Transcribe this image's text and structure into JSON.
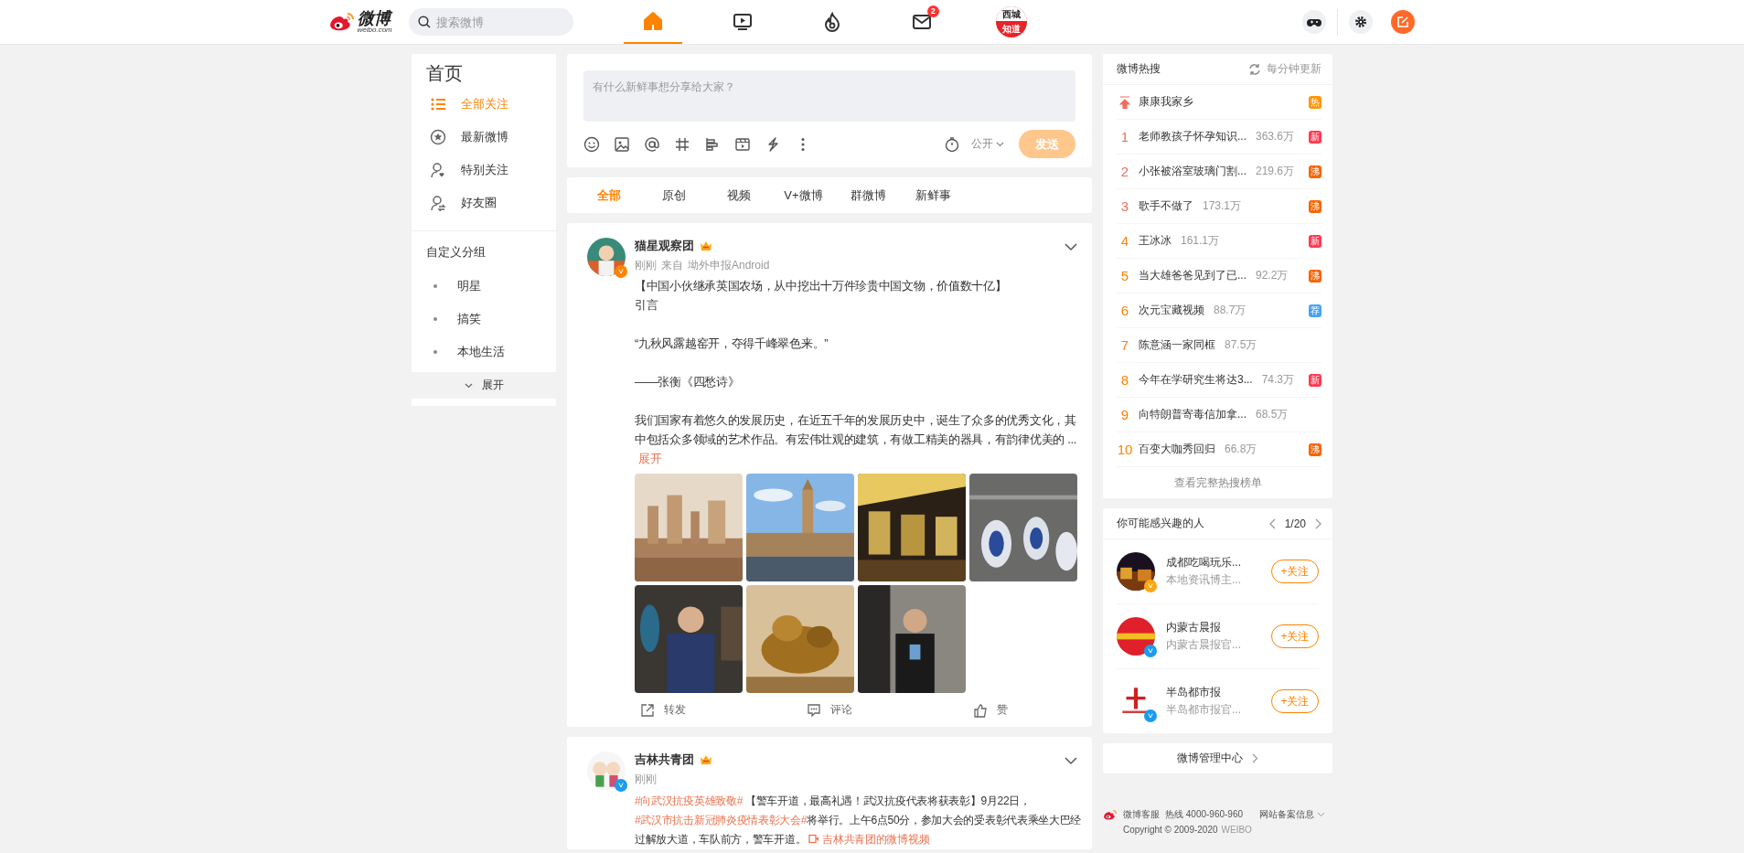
{
  "topbar": {
    "logo_text": "微博",
    "logo_sub": "weibo.com",
    "search": {
      "placeholder": "搜索微博"
    },
    "nav": [
      {
        "selected": true
      },
      {
        "selected": false
      },
      {
        "selected": false
      },
      {
        "selected": false,
        "badge": "2"
      },
      {
        "selected": false,
        "lines": [
          "西城",
          "知道"
        ]
      }
    ]
  },
  "sidebar": {
    "title": "首页",
    "items": [
      {
        "label": "全部关注",
        "selected": true
      },
      {
        "label": "最新微博",
        "selected": false
      },
      {
        "label": "特别关注",
        "selected": false
      },
      {
        "label": "好友圈",
        "selected": false
      }
    ],
    "groups_title": "自定义分组",
    "groups": [
      "明星",
      "搞笑",
      "本地生活"
    ],
    "expand": "展开"
  },
  "compose": {
    "placeholder": "有什么新鲜事想分享给大家？",
    "visibility": "公开",
    "send": {
      "label": "发送",
      "disabled": true
    }
  },
  "feed_tabs": [
    {
      "label": "全部",
      "selected": true
    },
    {
      "label": "原创",
      "selected": false
    },
    {
      "label": "视频",
      "selected": false
    },
    {
      "label": "V+微博",
      "selected": false
    },
    {
      "label": "群微博",
      "selected": false
    },
    {
      "label": "新鲜事",
      "selected": false
    }
  ],
  "posts": [
    {
      "author": "猫星观察团",
      "badge": {
        "color": "#ff8200"
      },
      "time": "刚刚",
      "source_prefix": "来自",
      "source": "坳外申报Android",
      "paragraphs": [
        [
          "【中国小伙继承英国农场，从中挖出十万件珍贵中国文物，价值数十亿】",
          "引言"
        ],
        [
          "“九秋风露越窑开，夺得千峰翠色来。”"
        ],
        [
          "——张衡《四愁诗》"
        ],
        [
          "我们国家有着悠久的发展历史，在近五千年的发展历史中，诞生了众多的优秀文化，其中包括众多领域的艺术作品。有宏伟壮观的建筑，有做工精美的器具，有韵律优美的 ..."
        ]
      ],
      "more": "展开",
      "images": [
        {
          "kind": "picture"
        },
        {
          "kind": "picture"
        },
        {
          "kind": "picture"
        },
        {
          "kind": "picture"
        },
        {
          "kind": "picture"
        },
        {
          "kind": "picture"
        },
        {
          "kind": "picture"
        }
      ],
      "actions": [
        "转发",
        "评论",
        "赞"
      ]
    },
    {
      "author": "吉林共青团",
      "badge": {
        "color": "#1a9cf2"
      },
      "time": "刚刚",
      "segments": [
        {
          "kind": "topic",
          "text": "#向武汉抗疫英雄致敬#"
        },
        {
          "kind": "plain",
          "text": " 【警车开道，最高礼遇！武汉抗疫代表将获表彰】9月22日，"
        },
        {
          "kind": "topic",
          "text": "#武汉市抗击新冠肺炎疫情表彰大会#"
        },
        {
          "kind": "plain",
          "text": "将举行。上午6点50分，参加大会的受表彰代表乘坐大巴经过解放大道，车队前方，警车开道。 "
        },
        {
          "kind": "video",
          "text": "吉林共青团的微博视频"
        }
      ]
    }
  ],
  "hot": {
    "title": "微博热搜",
    "refresh": "每分钟更新",
    "footer": "查看完整热搜榜单",
    "items": [
      {
        "kind": "pinned",
        "title": "康康我家乡",
        "tag": {
          "label": "热",
          "color": "#ff9406"
        }
      },
      {
        "kind": "ranked",
        "rank": "1",
        "title": "老师教孩子怀孕知识...",
        "count": "363.6万",
        "tag": {
          "label": "新",
          "color": "#ff3852"
        }
      },
      {
        "kind": "ranked",
        "rank": "2",
        "title": "小张被浴室玻璃门割...",
        "count": "219.6万",
        "tag": {
          "label": "沸",
          "color": "#f86400"
        }
      },
      {
        "kind": "ranked",
        "rank": "3",
        "title": "歌手不做了",
        "count": "173.1万",
        "tag": {
          "label": "沸",
          "color": "#f86400"
        }
      },
      {
        "kind": "ranked",
        "rank": "4",
        "title": "王冰冰",
        "count": "161.1万",
        "tag": {
          "label": "新",
          "color": "#ff3852"
        }
      },
      {
        "kind": "ranked",
        "rank": "5",
        "title": "当大雄爸爸见到了已...",
        "count": "92.2万",
        "tag": {
          "label": "沸",
          "color": "#f86400"
        }
      },
      {
        "kind": "ranked",
        "rank": "6",
        "title": "次元宝藏视频",
        "count": "88.7万",
        "tag": {
          "label": "荐",
          "color": "#4aa2ee"
        }
      },
      {
        "kind": "ranked",
        "rank": "7",
        "title": "陈意涵一家同框",
        "count": "87.5万"
      },
      {
        "kind": "ranked",
        "rank": "8",
        "title": "今年在学研究生将达3...",
        "count": "74.3万",
        "tag": {
          "label": "新",
          "color": "#ff3852"
        }
      },
      {
        "kind": "ranked",
        "rank": "9",
        "title": "向特朗普寄毒信加拿...",
        "count": "68.5万"
      },
      {
        "kind": "ranked",
        "rank": "10",
        "title": "百变大咖秀回归",
        "count": "66.8万",
        "tag": {
          "label": "沸",
          "color": "#f86400"
        }
      }
    ]
  },
  "interested": {
    "title": "你可能感兴趣的人",
    "pager": "1/20",
    "people": [
      {
        "name": "成都吃喝玩乐...",
        "desc": "本地资讯博主...",
        "badge": {
          "color": "#ffa70f"
        },
        "follow": "+关注"
      },
      {
        "name": "内蒙古晨报",
        "desc": "内蒙古晨报官...",
        "badge": {
          "color": "#1a9cf2"
        },
        "follow": "+关注"
      },
      {
        "name": "半岛都市报",
        "desc": "半岛都市报官...",
        "badge": {
          "color": "#1a9cf2"
        },
        "follow": "+关注"
      }
    ]
  },
  "manage": "微博管理中心",
  "footer": {
    "service": "微博客服",
    "hotline": "热线 4000-960-960",
    "record": "网站备案信息",
    "copyright": "Copyright © 2009-2020",
    "brand": "WEIBO"
  }
}
